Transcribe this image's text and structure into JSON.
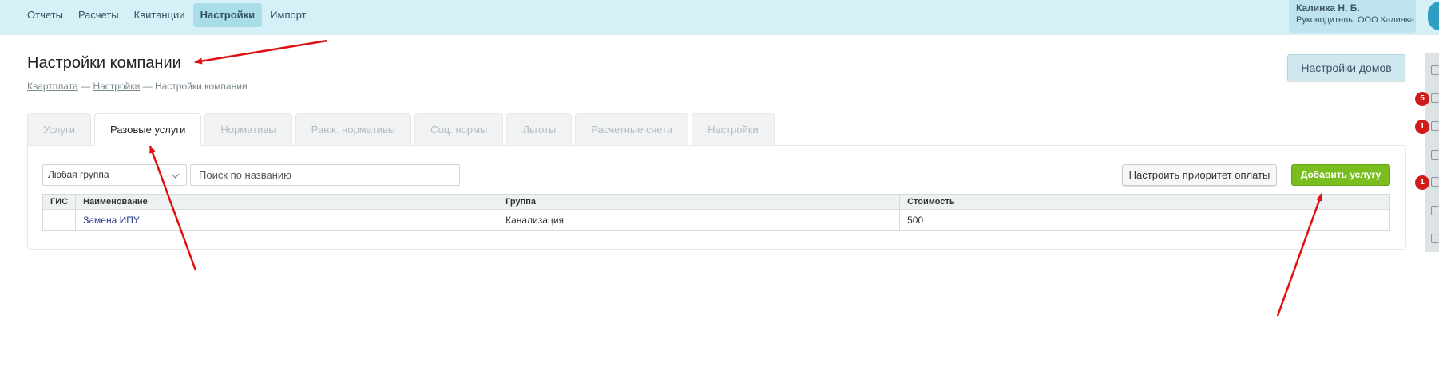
{
  "nav": {
    "items": [
      {
        "label": "Отчеты",
        "active": false
      },
      {
        "label": "Расчеты",
        "active": false
      },
      {
        "label": "Квитанции",
        "active": false
      },
      {
        "label": "Настройки",
        "active": true
      },
      {
        "label": "Импорт",
        "active": false
      }
    ]
  },
  "user": {
    "name": "Калинка Н. Б.",
    "role": "Руководитель, ООО Калинка"
  },
  "page": {
    "title": "Настройки компании",
    "houses_settings_button": "Настройки домов"
  },
  "breadcrumb": {
    "items": [
      "Квартплата",
      "Настройки",
      "Настройки компании"
    ],
    "separator": " — "
  },
  "tabs": [
    {
      "label": "Услуги",
      "active": false
    },
    {
      "label": "Разовые услуги",
      "active": true
    },
    {
      "label": "Нормативы",
      "active": false
    },
    {
      "label": "Ранж. нормативы",
      "active": false
    },
    {
      "label": "Соц. нормы",
      "active": false
    },
    {
      "label": "Льготы",
      "active": false
    },
    {
      "label": "Расчетные счета",
      "active": false
    },
    {
      "label": "Настройки",
      "active": false
    }
  ],
  "filters": {
    "group_select_value": "Любая группа",
    "search_placeholder": "Поиск по названию"
  },
  "actions": {
    "priority_button": "Настроить приоритет оплаты",
    "add_service_button": "Добавить услугу"
  },
  "table": {
    "headers": [
      "ГИС",
      "Наименование",
      "Группа",
      "Стоимость"
    ],
    "rows": [
      {
        "gis": "",
        "name": "Замена ИПУ",
        "group": "Канализация",
        "cost": "500"
      }
    ]
  },
  "side_badges": [
    "5",
    "1",
    "1"
  ],
  "colors": {
    "topbar": "#d5f0f7",
    "add_button": "#79be1e",
    "annotation_arrow": "#e01010",
    "badge": "#d11b1b"
  }
}
